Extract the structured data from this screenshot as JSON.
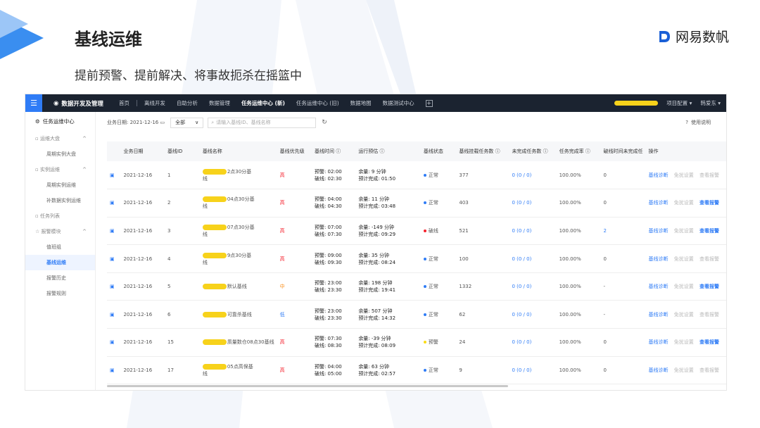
{
  "slide": {
    "title": "基线运维",
    "subtitle": "提前预警、提前解决、将事故扼杀在摇篮中",
    "brand": "网易数帆"
  },
  "topbar": {
    "app_name": "数据开发及管理",
    "nav": [
      {
        "label": "首页",
        "active": false
      },
      {
        "label": "离线开发",
        "active": false
      },
      {
        "label": "自助分析",
        "active": false
      },
      {
        "label": "数据管理",
        "active": false
      },
      {
        "label": "任务运维中心 (新)",
        "active": true
      },
      {
        "label": "任务运维中心 (旧)",
        "active": false
      },
      {
        "label": "数据地图",
        "active": false
      },
      {
        "label": "数据测试中心",
        "active": false
      }
    ],
    "plus": "+",
    "config": "项目配置",
    "user": "韩爱东"
  },
  "sidebar": {
    "header": "任务运维中心",
    "groups": [
      {
        "label": "运维大盘",
        "items": [
          {
            "label": "周期实例大盘",
            "active": false
          }
        ]
      },
      {
        "label": "实例运维",
        "items": [
          {
            "label": "周期实例运维",
            "active": false
          },
          {
            "label": "补数据实例运维",
            "active": false
          }
        ]
      },
      {
        "label": "任务列表",
        "items": []
      },
      {
        "label": "报警模块",
        "items": [
          {
            "label": "值班组",
            "active": false
          },
          {
            "label": "基线运维",
            "active": true
          },
          {
            "label": "报警历史",
            "active": false
          },
          {
            "label": "报警规则",
            "active": false
          }
        ]
      }
    ]
  },
  "filter": {
    "date_label": "业务日期: 2021-12-16",
    "select_value": "全部",
    "search_placeholder": "请输入基线ID、基线名称",
    "help": "使用说明"
  },
  "table": {
    "headers": [
      "业务日期",
      "基线ID",
      "基线名称",
      "基线优先级",
      "基线时间",
      "运行预估",
      "基线状态",
      "基线挂载任务数",
      "未完成任务数",
      "任务完成率",
      "破线时间未完成任",
      "操作"
    ],
    "ops": {
      "diagnose": "基线诊断",
      "exempt": "免扰设置",
      "alarm": "查看报警"
    },
    "rows": [
      {
        "date": "2021-12-16",
        "id": "1",
        "name_visible": "2点30分基",
        "name_tail": "线",
        "priority": "高",
        "pri_class": "pri-high",
        "warn": "预警: 02:00",
        "break": "破线: 02:30",
        "margin": "余量: 9 分钟",
        "eta": "预计完成: 01:50",
        "status": "正常",
        "status_color": "#2f7cf6",
        "tasks": "377",
        "unfinished": "0 (0 / 0)",
        "rate": "100.00%",
        "overdue": "0",
        "alarm_active": false
      },
      {
        "date": "2021-12-16",
        "id": "2",
        "name_visible": "04点30分基",
        "name_tail": "线",
        "priority": "高",
        "pri_class": "pri-high",
        "warn": "预警: 04:00",
        "break": "破线: 04:30",
        "margin": "余量: 11 分钟",
        "eta": "预计完成: 03:48",
        "status": "正常",
        "status_color": "#2f7cf6",
        "tasks": "403",
        "unfinished": "0 (0 / 0)",
        "rate": "100.00%",
        "overdue": "0",
        "alarm_active": true
      },
      {
        "date": "2021-12-16",
        "id": "3",
        "name_visible": "07点30分基",
        "name_tail": "线",
        "priority": "高",
        "pri_class": "pri-high",
        "warn": "预警: 07:00",
        "break": "破线: 07:30",
        "margin": "余量: -149 分钟",
        "eta": "预计完成: 09:29",
        "status": "破线",
        "status_color": "#f5222d",
        "tasks": "521",
        "unfinished": "0 (0 / 0)",
        "rate": "100.00%",
        "overdue": "2",
        "alarm_active": true
      },
      {
        "date": "2021-12-16",
        "id": "4",
        "name_visible": "9点30分基",
        "name_tail": "线",
        "priority": "高",
        "pri_class": "pri-high",
        "warn": "预警: 09:00",
        "break": "破线: 09:30",
        "margin": "余量: 35 分钟",
        "eta": "预计完成: 08:24",
        "status": "正常",
        "status_color": "#2f7cf6",
        "tasks": "100",
        "unfinished": "0 (0 / 0)",
        "rate": "100.00%",
        "overdue": "0",
        "alarm_active": false
      },
      {
        "date": "2021-12-16",
        "id": "5",
        "name_visible": "默认基线",
        "name_tail": "",
        "priority": "中",
        "pri_class": "pri-mid",
        "warn": "预警: 23:00",
        "break": "破线: 23:30",
        "margin": "余量: 198 分钟",
        "eta": "预计完成: 19:41",
        "status": "正常",
        "status_color": "#2f7cf6",
        "tasks": "1332",
        "unfinished": "0 (0 / 0)",
        "rate": "100.00%",
        "overdue": "-",
        "alarm_active": true
      },
      {
        "date": "2021-12-16",
        "id": "6",
        "name_visible": "可靠杀基线",
        "name_tail": "",
        "priority": "低",
        "pri_class": "pri-low",
        "warn": "预警: 23:00",
        "break": "破线: 23:30",
        "margin": "余量: 507 分钟",
        "eta": "预计完成: 14:32",
        "status": "正常",
        "status_color": "#2f7cf6",
        "tasks": "62",
        "unfinished": "0 (0 / 0)",
        "rate": "100.00%",
        "overdue": "-",
        "alarm_active": false
      },
      {
        "date": "2021-12-16",
        "id": "15",
        "name_visible": "质量数仓08点30基线",
        "name_tail": "",
        "priority": "高",
        "pri_class": "pri-high",
        "warn": "预警: 07:30",
        "break": "破线: 08:30",
        "margin": "余量: -39 分钟",
        "eta": "预计完成: 08:09",
        "status": "预警",
        "status_color": "#fadb14",
        "tasks": "24",
        "unfinished": "0 (0 / 0)",
        "rate": "100.00%",
        "overdue": "0",
        "alarm_active": true
      },
      {
        "date": "2021-12-16",
        "id": "17",
        "name_visible": "05点高保基",
        "name_tail": "线",
        "priority": "高",
        "pri_class": "pri-high",
        "warn": "预警: 04:00",
        "break": "破线: 05:00",
        "margin": "余量: 63 分钟",
        "eta": "预计完成: 02:57",
        "status": "正常",
        "status_color": "#2f7cf6",
        "tasks": "9",
        "unfinished": "0 (0 / 0)",
        "rate": "100.00%",
        "overdue": "0",
        "alarm_active": false
      }
    ]
  }
}
